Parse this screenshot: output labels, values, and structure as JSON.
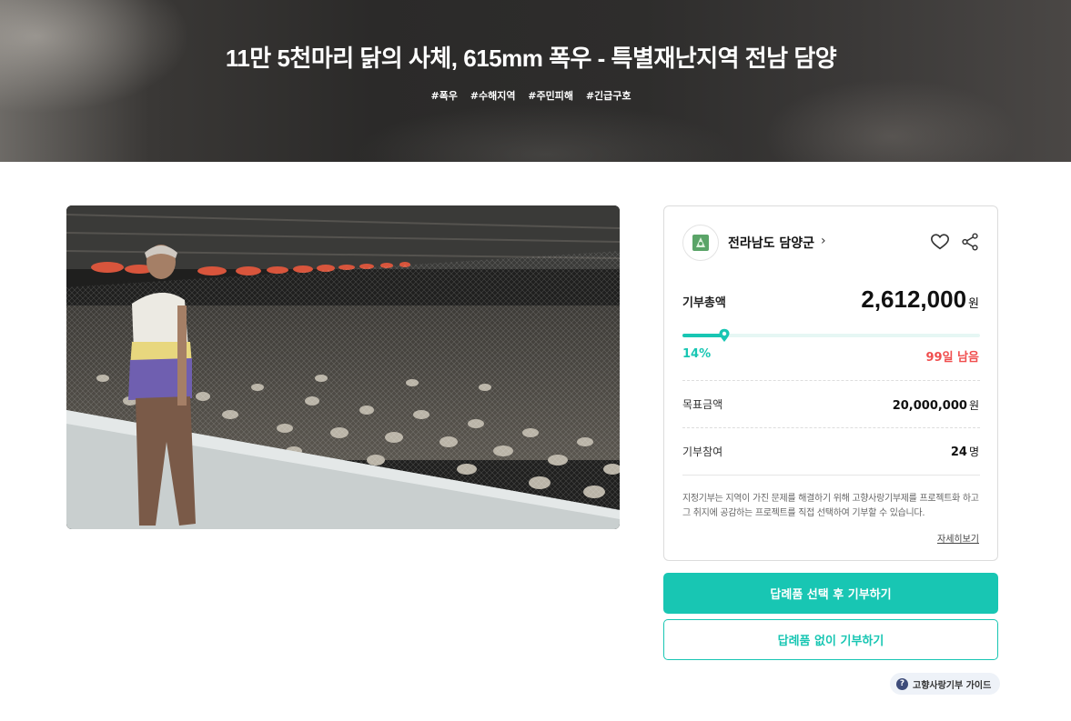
{
  "hero": {
    "title": "11만 5천마리 닭의 사체, 615mm 폭우 - 특별재난지역 전남 담양",
    "tags": [
      "#폭우",
      "#수해지역",
      "#주민피해",
      "#긴급구호"
    ]
  },
  "org": {
    "name": "전라남도 담양군",
    "chevron": "›",
    "logo_icon": "damyang-county-seal-icon"
  },
  "actions": {
    "heart_icon": "heart-outline-icon",
    "share_icon": "share-icon"
  },
  "donation": {
    "total_label": "기부총액",
    "total_amount": "2,612,000",
    "total_unit": "원",
    "progress_percent": 14,
    "percent_label": "14%",
    "remaining_label": "99일 남음",
    "goal_label": "목표금액",
    "goal_amount": "20,000,000",
    "goal_unit": "원",
    "participants_label": "기부참여",
    "participants_count": "24",
    "participants_unit": "명"
  },
  "notice": {
    "text": "지정기부는 지역이 가진 문제를 해결하기 위해 고향사랑기부제를 프로젝트화 하고 그 취지에 공감하는 프로젝트를 직접 선택하여 기부할 수 있습니다.",
    "more_link": "자세히보기"
  },
  "buttons": {
    "primary": "답례품 선택 후 기부하기",
    "secondary": "답례품 없이 기부하기"
  },
  "guide": {
    "icon_text": "?",
    "label": "고향사랑기부 가이드"
  },
  "colors": {
    "accent": "#18c6b3",
    "danger": "#f04e4e"
  }
}
